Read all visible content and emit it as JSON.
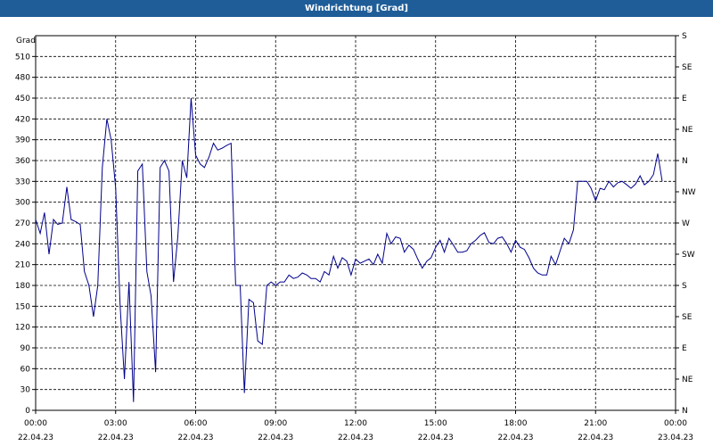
{
  "window": {
    "title": "Windrichtung [Grad]"
  },
  "chart_data": {
    "type": "line",
    "ylabel": "Grad",
    "ylim": [
      0,
      540
    ],
    "yticks": [
      0,
      30,
      60,
      90,
      120,
      150,
      180,
      210,
      240,
      270,
      300,
      330,
      360,
      390,
      420,
      450,
      480,
      510
    ],
    "right_axis": {
      "labels": [
        "N",
        "NE",
        "E",
        "SE",
        "S",
        "SW",
        "W",
        "NW",
        "N",
        "NE",
        "E",
        "SE",
        "S"
      ],
      "values": [
        0,
        45,
        90,
        135,
        180,
        225,
        270,
        315,
        360,
        405,
        450,
        495,
        540
      ]
    },
    "x_ticks": [
      {
        "time": "00:00",
        "date": "22.04.23"
      },
      {
        "time": "03:00",
        "date": "22.04.23"
      },
      {
        "time": "06:00",
        "date": "22.04.23"
      },
      {
        "time": "09:00",
        "date": "22.04.23"
      },
      {
        "time": "12:00",
        "date": "22.04.23"
      },
      {
        "time": "15:00",
        "date": "22.04.23"
      },
      {
        "time": "18:00",
        "date": "22.04.23"
      },
      {
        "time": "21:00",
        "date": "22.04.23"
      },
      {
        "time": "00:00",
        "date": "23.04.23"
      }
    ],
    "grid": true,
    "line_color": "#00008b",
    "series": [
      {
        "x_hours": [
          0,
          0.17,
          0.33,
          0.5,
          0.67,
          0.83,
          1.0,
          1.17,
          1.33,
          1.5,
          1.67,
          1.83,
          2.0,
          2.17,
          2.33,
          2.5,
          2.67,
          2.83,
          3.0,
          3.17,
          3.33,
          3.5,
          3.67,
          3.83,
          4.0,
          4.17,
          4.33,
          4.5,
          4.67,
          4.83,
          5.0,
          5.17,
          5.33,
          5.5,
          5.67,
          5.83,
          6.0,
          6.17,
          6.33,
          6.5,
          6.67,
          6.83,
          7.0,
          7.17,
          7.33,
          7.5,
          7.67,
          7.83,
          8.0,
          8.17,
          8.33,
          8.5,
          8.67,
          8.83,
          9.0,
          9.17,
          9.33,
          9.5,
          9.67,
          9.83,
          10.0,
          10.17,
          10.33,
          10.5,
          10.67,
          10.83,
          11.0,
          11.17,
          11.33,
          11.5,
          11.67,
          11.83,
          12.0,
          12.17,
          12.33,
          12.5,
          12.67,
          12.83,
          13.0,
          13.17,
          13.33,
          13.5,
          13.67,
          13.83,
          14.0,
          14.17,
          14.33,
          14.5,
          14.67,
          14.83,
          15.0,
          15.17,
          15.33,
          15.5,
          15.67,
          15.83,
          16.0,
          16.17,
          16.33,
          16.5,
          16.67,
          16.83,
          17.0,
          17.17,
          17.33,
          17.5,
          17.67,
          17.83,
          18.0,
          18.17,
          18.33,
          18.5,
          18.67,
          18.83,
          19.0,
          19.17,
          19.33,
          19.5,
          19.67,
          19.83,
          20.0,
          20.17,
          20.33,
          20.5,
          20.67,
          20.83,
          21.0,
          21.17,
          21.33,
          21.5,
          21.67,
          21.83,
          22.0,
          22.17,
          22.33,
          22.5,
          22.67,
          22.83,
          23.0,
          23.17,
          23.33,
          23.5,
          23.67,
          23.83,
          24.0
        ],
        "values": [
          275,
          255,
          285,
          225,
          275,
          268,
          270,
          322,
          275,
          272,
          268,
          200,
          180,
          135,
          180,
          350,
          420,
          390,
          320,
          150,
          45,
          185,
          12,
          345,
          355,
          200,
          165,
          55,
          350,
          360,
          345,
          185,
          250,
          360,
          335,
          450,
          368,
          355,
          350,
          365,
          385,
          375,
          378,
          382,
          385,
          180,
          180,
          25,
          160,
          155,
          100,
          95,
          180,
          185,
          180,
          185,
          185,
          195,
          190,
          192,
          198,
          195,
          190,
          190,
          185,
          200,
          195,
          222,
          205,
          220,
          215,
          195,
          218,
          212,
          215,
          218,
          210,
          225,
          212,
          255,
          240,
          250,
          248,
          228,
          238,
          232,
          218,
          205,
          215,
          220,
          235,
          245,
          228,
          248,
          238,
          228,
          228,
          230,
          240,
          245,
          252,
          256,
          242,
          240,
          248,
          250,
          240,
          228,
          245,
          235,
          232,
          220,
          205,
          198,
          195,
          195,
          222,
          210,
          230,
          248,
          240,
          260,
          330,
          330,
          330,
          320,
          302,
          320,
          318,
          330,
          322,
          328,
          330,
          325,
          320,
          326,
          338,
          325,
          330,
          340,
          370,
          330
        ]
      }
    ]
  }
}
